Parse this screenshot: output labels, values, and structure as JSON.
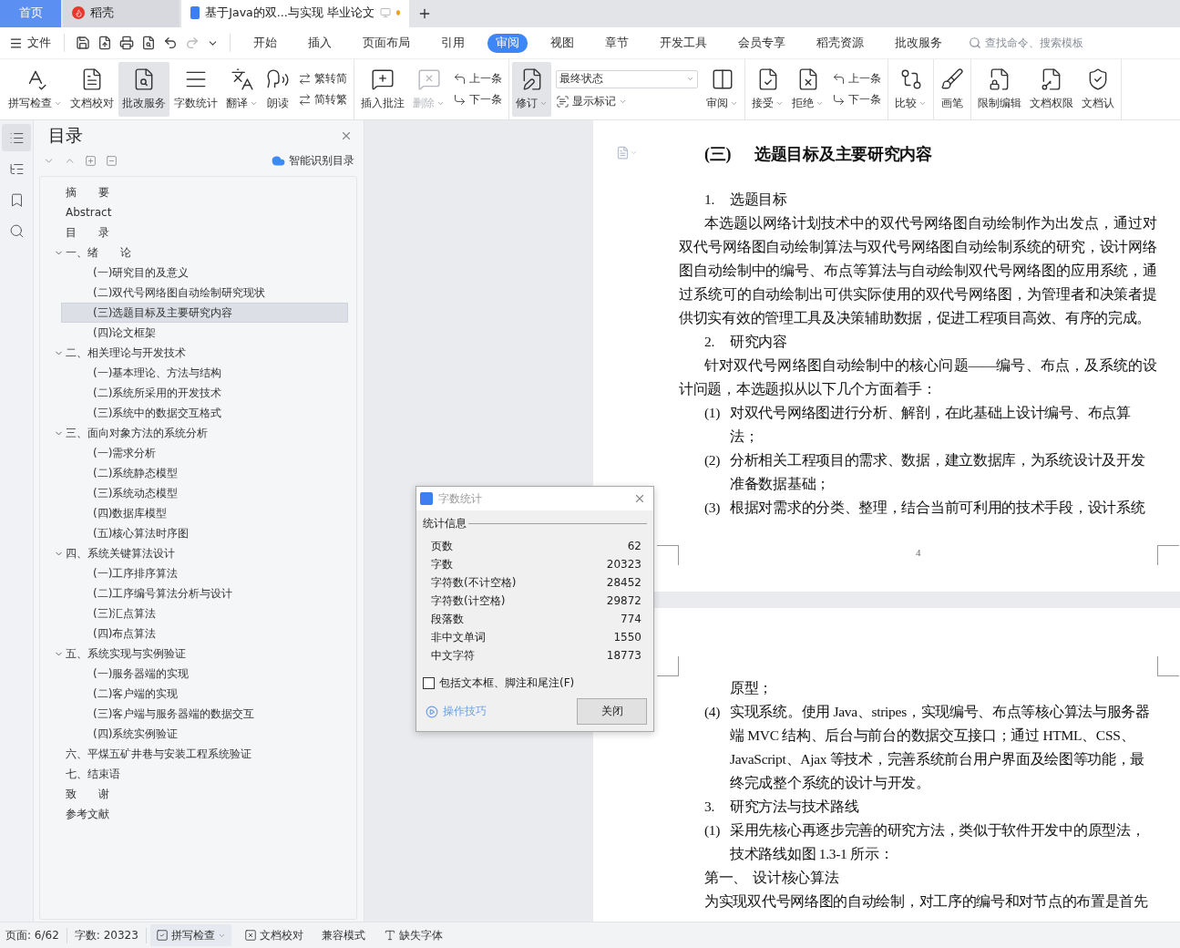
{
  "tabs": [
    {
      "kind": "home",
      "label": "首页",
      "selected": false
    },
    {
      "kind": "app",
      "label": "稻壳",
      "selected": false
    },
    {
      "kind": "doc",
      "label": "基于Java的双...与实现 毕业论文",
      "selected": true,
      "unsaved": true
    }
  ],
  "menu": {
    "file": "文件",
    "tabs": [
      {
        "label": "开始",
        "selected": false
      },
      {
        "label": "插入",
        "selected": false
      },
      {
        "label": "页面布局",
        "selected": false
      },
      {
        "label": "引用",
        "selected": false
      },
      {
        "label": "审阅",
        "selected": true
      },
      {
        "label": "视图",
        "selected": false
      },
      {
        "label": "章节",
        "selected": false
      },
      {
        "label": "开发工具",
        "selected": false
      },
      {
        "label": "会员专享",
        "selected": false
      },
      {
        "label": "稻壳资源",
        "selected": false
      },
      {
        "label": "批改服务",
        "selected": false
      }
    ],
    "search": {
      "placeholder": "查找命令、搜索模板"
    }
  },
  "ribbon": [
    {
      "items": [
        {
          "kind": "large",
          "label": "拼写检查",
          "dropdown": true,
          "active": false,
          "disabled": false
        },
        {
          "kind": "large",
          "label": "文档校对",
          "dropdown": false,
          "active": false,
          "disabled": false
        },
        {
          "kind": "large",
          "label": "批改服务",
          "dropdown": false,
          "active": true,
          "disabled": false
        },
        {
          "kind": "large",
          "label": "字数统计",
          "dropdown": false,
          "active": false,
          "disabled": false
        },
        {
          "kind": "large",
          "label": "翻译",
          "dropdown": true,
          "active": false,
          "disabled": false
        },
        {
          "kind": "large",
          "label": "朗读",
          "dropdown": false,
          "active": false,
          "disabled": false
        },
        {
          "kind": "stack",
          "items": [
            {
              "kind": "small",
              "label": "繁转简",
              "dropdown": false
            },
            {
              "kind": "small",
              "label": "简转繁",
              "dropdown": false
            }
          ]
        }
      ]
    },
    {
      "items": [
        {
          "kind": "large",
          "label": "插入批注",
          "dropdown": false,
          "active": false,
          "disabled": false
        },
        {
          "kind": "large",
          "label": "删除",
          "dropdown": true,
          "active": false,
          "disabled": true
        },
        {
          "kind": "stack",
          "items": [
            {
              "kind": "small",
              "label": "上一条",
              "dropdown": false
            },
            {
              "kind": "small",
              "label": "下一条",
              "dropdown": false
            }
          ]
        }
      ]
    },
    {
      "items": [
        {
          "kind": "large",
          "label": "修订",
          "dropdown": true,
          "active": true,
          "disabled": false
        },
        {
          "kind": "stack",
          "items": [
            {
              "kind": "select",
              "value": "最终状态"
            },
            {
              "kind": "small",
              "label": "显示标记",
              "dropdown": true
            }
          ]
        },
        {
          "kind": "large",
          "label": "审阅",
          "dropdown": true,
          "active": false,
          "disabled": false
        }
      ]
    },
    {
      "items": [
        {
          "kind": "large",
          "label": "接受",
          "dropdown": true,
          "active": false,
          "disabled": false
        },
        {
          "kind": "large",
          "label": "拒绝",
          "dropdown": true,
          "active": false,
          "disabled": false
        },
        {
          "kind": "stack",
          "items": [
            {
              "kind": "small",
              "label": "上一条",
              "dropdown": false
            },
            {
              "kind": "small",
              "label": "下一条",
              "dropdown": false
            }
          ]
        }
      ]
    },
    {
      "items": [
        {
          "kind": "large",
          "label": "比较",
          "dropdown": true,
          "active": false,
          "disabled": false
        }
      ]
    },
    {
      "items": [
        {
          "kind": "large",
          "label": "画笔",
          "dropdown": false,
          "active": false,
          "disabled": false
        }
      ]
    },
    {
      "items": [
        {
          "kind": "large",
          "label": "限制编辑",
          "dropdown": false,
          "active": false,
          "disabled": false
        },
        {
          "kind": "large",
          "label": "文档权限",
          "dropdown": false,
          "active": false,
          "disabled": false
        },
        {
          "kind": "large",
          "label": "文档认",
          "dropdown": false,
          "active": false,
          "disabled": false
        }
      ]
    }
  ],
  "rail": [
    {
      "selected": true
    },
    {
      "selected": false
    },
    {
      "selected": false
    },
    {
      "selected": false
    }
  ],
  "toc": {
    "title": "目录",
    "smart": "智能识别目录",
    "items": [
      {
        "label": "摘　　要",
        "selected": false
      },
      {
        "label": "Abstract",
        "selected": false
      },
      {
        "label": "目　　录",
        "selected": false
      },
      {
        "label": "一、绪　　论",
        "selected": false,
        "expanded": true,
        "children": [
          {
            "label": "(一)研究目的及意义",
            "selected": false
          },
          {
            "label": "(二)双代号网络图自动绘制研究现状",
            "selected": false
          },
          {
            "label": "(三)选题目标及主要研究内容",
            "selected": true
          },
          {
            "label": "(四)论文框架",
            "selected": false
          }
        ]
      },
      {
        "label": "二、相关理论与开发技术",
        "selected": false,
        "expanded": true,
        "children": [
          {
            "label": "(一)基本理论、方法与结构",
            "selected": false
          },
          {
            "label": "(二)系统所采用的开发技术",
            "selected": false
          },
          {
            "label": "(三)系统中的数据交互格式",
            "selected": false
          }
        ]
      },
      {
        "label": "三、面向对象方法的系统分析",
        "selected": false,
        "expanded": true,
        "children": [
          {
            "label": "(一)需求分析",
            "selected": false
          },
          {
            "label": "(二)系统静态模型",
            "selected": false
          },
          {
            "label": "(三)系统动态模型",
            "selected": false
          },
          {
            "label": "(四)数据库模型",
            "selected": false
          },
          {
            "label": "(五)核心算法时序图",
            "selected": false
          }
        ]
      },
      {
        "label": "四、系统关键算法设计",
        "selected": false,
        "expanded": true,
        "children": [
          {
            "label": "(一)工序排序算法",
            "selected": false
          },
          {
            "label": "(二)工序编号算法分析与设计",
            "selected": false
          },
          {
            "label": "(三)汇点算法",
            "selected": false
          },
          {
            "label": "(四)布点算法",
            "selected": false
          }
        ]
      },
      {
        "label": "五、系统实现与实例验证",
        "selected": false,
        "expanded": true,
        "children": [
          {
            "label": "(一)服务器端的实现",
            "selected": false
          },
          {
            "label": "(二)客户端的实现",
            "selected": false
          },
          {
            "label": "(三)客户端与服务器端的数据交互",
            "selected": false
          },
          {
            "label": "(四)系统实例验证",
            "selected": false
          }
        ]
      },
      {
        "label": "六、平煤五矿井巷与安装工程系统验证",
        "selected": false
      },
      {
        "label": "七、结束语",
        "selected": false
      },
      {
        "label": "致　　谢",
        "selected": false
      },
      {
        "label": "参考文献",
        "selected": false
      }
    ]
  },
  "document": {
    "pages": [
      {
        "page_number": "4",
        "blocks": [
          {
            "kind": "heading",
            "number": "(三)",
            "text": "选题目标及主要研究内容"
          },
          {
            "kind": "numbered",
            "number": "1.",
            "text": "选题目标"
          },
          {
            "kind": "para",
            "text": "本选题以网络计划技术中的双代号网络图自动绘制作为出发点，通过对双代号网络图自动绘制算法与双代号网络图自动绘制系统的研究，设计网络图自动绘制中的编号、布点等算法与自动绘制双代号网络图的应用系统，通过系统可的自动绘制出可供实际使用的双代号网络图，为管理者和决策者提供切实有效的管理工具及决策辅助数据，促进工程项目高效、有序的完成。"
          },
          {
            "kind": "numbered",
            "number": "2.",
            "text": "研究内容"
          },
          {
            "kind": "para",
            "text": "针对双代号网络图自动绘制中的核心问题——编号、布点，及系统的设计问题，本选题拟从以下几个方面着手："
          },
          {
            "kind": "numbered",
            "number": "(1)",
            "text": "对双代号网络图进行分析、解剖，在此基础上设计编号、布点算法；"
          },
          {
            "kind": "numbered",
            "number": "(2)",
            "text": "分析相关工程项目的需求、数据，建立数据库，为系统设计及开发准备数据基础；"
          },
          {
            "kind": "numbered",
            "number": "(3)",
            "text": "根据对需求的分类、整理，结合当前可利用的技术手段，设计系统"
          }
        ]
      },
      {
        "blocks": [
          {
            "kind": "continuation",
            "text": "原型；"
          },
          {
            "kind": "numbered",
            "number": "(4)",
            "text": "实现系统。使用 Java、stripes，实现编号、布点等核心算法与服务器端 MVC 结构、后台与前台的数据交互接口；通过 HTML、CSS、JavaScript、Ajax 等技术，完善系统前台用户界面及绘图等功能，最终完成整个系统的设计与开发。"
          },
          {
            "kind": "numbered",
            "number": "3.",
            "text": "研究方法与技术路线"
          },
          {
            "kind": "numbered",
            "number": "(1)",
            "text": "采用先核心再逐步完善的研究方法，类似于软件开发中的原型法，技术路线如图 1.3-1 所示："
          },
          {
            "kind": "numbered",
            "number": "第一、",
            "text": "设计核心算法"
          },
          {
            "kind": "para",
            "text": "为实现双代号网络图的自动绘制，对工序的编号和对节点的布置是首先"
          }
        ]
      }
    ]
  },
  "dialog": {
    "title": "字数统计",
    "section": "统计信息",
    "rows": [
      {
        "label": "页数",
        "value": "62"
      },
      {
        "label": "字数",
        "value": "20323"
      },
      {
        "label": "字符数(不计空格)",
        "value": "28452"
      },
      {
        "label": "字符数(计空格)",
        "value": "29872"
      },
      {
        "label": "段落数",
        "value": "774"
      },
      {
        "label": "非中文单词",
        "value": "1550"
      },
      {
        "label": "中文字符",
        "value": "18773"
      }
    ],
    "checkbox": {
      "label": "包括文本框、脚注和尾注(F)",
      "checked": false
    },
    "tips": "操作技巧",
    "close": "关闭"
  },
  "status_bar": {
    "page": "页面: 6/62",
    "words": "字数: 20323",
    "buttons": [
      {
        "label": "拼写检查",
        "dropdown": true,
        "active": true
      },
      {
        "label": "文档校对",
        "dropdown": false,
        "active": false
      },
      {
        "label": "兼容模式",
        "dropdown": false,
        "active": false
      },
      {
        "label": "缺失字体",
        "dropdown": false,
        "active": false
      }
    ]
  }
}
